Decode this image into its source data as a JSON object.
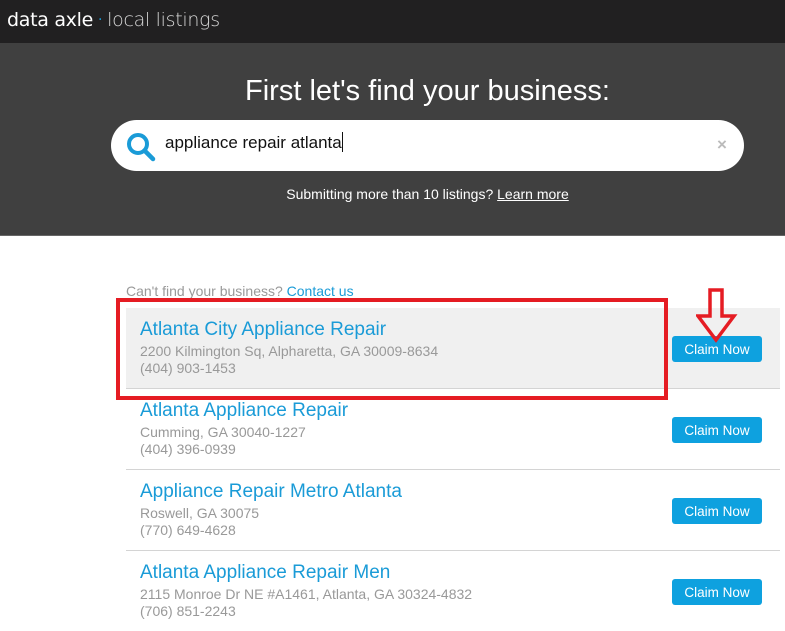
{
  "header": {
    "brand": "data axle",
    "separator": "·",
    "product": "local listings"
  },
  "hero": {
    "title": "First let's find your business:",
    "search": {
      "value": "appliance repair atlanta",
      "icon": "search-icon",
      "clear_icon": "×"
    },
    "hint_text": "Submitting more than 10 listings?",
    "hint_link": "Learn more"
  },
  "results": {
    "cant_find_text": "Can't find your business?",
    "contact_link": "Contact us",
    "items": [
      {
        "name": "Atlanta City Appliance Repair",
        "address": "2200 Kilmington Sq, Alpharetta, GA 30009-8634",
        "phone": "(404) 903-1453",
        "button": "Claim Now"
      },
      {
        "name": "Atlanta Appliance Repair",
        "address": "Cumming, GA 30040-1227",
        "phone": "(404) 396-0939",
        "button": "Claim Now"
      },
      {
        "name": "Appliance Repair Metro Atlanta",
        "address": "Roswell, GA 30075",
        "phone": "(770) 649-4628",
        "button": "Claim Now"
      },
      {
        "name": "Atlanta Appliance Repair Men",
        "address": "2115 Monroe Dr NE #A1461, Atlanta, GA 30324-4832",
        "phone": "(706) 851-2243",
        "button": "Claim Now"
      }
    ]
  },
  "colors": {
    "accent": "#1a9bd7",
    "button": "#0ea1df",
    "annotation": "#e51c23"
  }
}
